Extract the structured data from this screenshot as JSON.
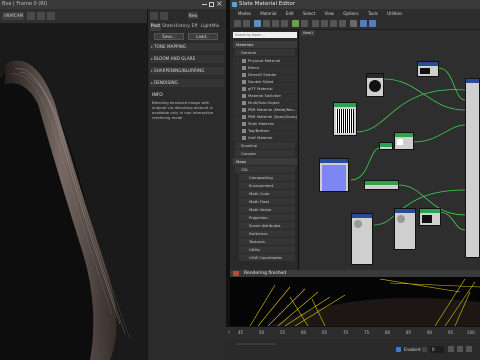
{
  "left_window": {
    "title": "Bve | Frame 0 (RI)",
    "camera_label": "VRAYCAM",
    "vfb_tabs": [
      "Post",
      "Stats",
      "History",
      "Eff",
      "LightMix"
    ],
    "buttons": {
      "save": "Save...",
      "load": "Load..."
    },
    "sections": [
      "TONE MAPPING",
      "BLOOM AND GLARE",
      "SHARPENING/BLURRING",
      "DENOISING"
    ],
    "info_heading": "INFO",
    "info_text": "Blending denoised image with original via denoising amount is available only in non-interactive rendering mode"
  },
  "slate": {
    "title": "Slate Material Editor",
    "menu": [
      "Modes",
      "Material",
      "Edit",
      "Select",
      "View",
      "Options",
      "Tools",
      "Utilities"
    ],
    "view_tab": "View1",
    "search_placeholder": "Search by Name ...",
    "materials_group": "Materials",
    "general_group": "General",
    "materials": [
      "Physical Material",
      "Blend",
      "DirectX Shader",
      "Double Sided",
      "glTF Material",
      "Material Switcher",
      "Multi/Sub-Object",
      "PBR Material (Metal/Rou...",
      "PBR Material (Spec/Gloss)",
      "Shell Material",
      "Top/Bottom",
      "Xref Material"
    ],
    "collapsed_groups": [
      "Scanline",
      "Coronar"
    ],
    "maps_group": "Maps",
    "osl_group": "OSL",
    "osl_items": [
      "Compositing",
      "Environment",
      "Math Color",
      "Math Float",
      "Math Vector",
      "Projection",
      "Scene Attributes",
      "Switchers",
      "Textures",
      "Utility",
      "UVW Coordinates"
    ],
    "render_bar_label": "Rendering finished"
  },
  "colors": {
    "node_header_green": "#2aa34a",
    "node_header_blue": "#2a4a9a",
    "wire": "#39d353",
    "render_lines": "#d8c800"
  },
  "timeline": {
    "ticks": [
      "45",
      "50",
      "55",
      "60",
      "65",
      "70",
      "75",
      "80",
      "85",
      "90",
      "95",
      "100"
    ]
  },
  "status": {
    "enabled_label": "Enabled:",
    "frame_value": "0"
  }
}
